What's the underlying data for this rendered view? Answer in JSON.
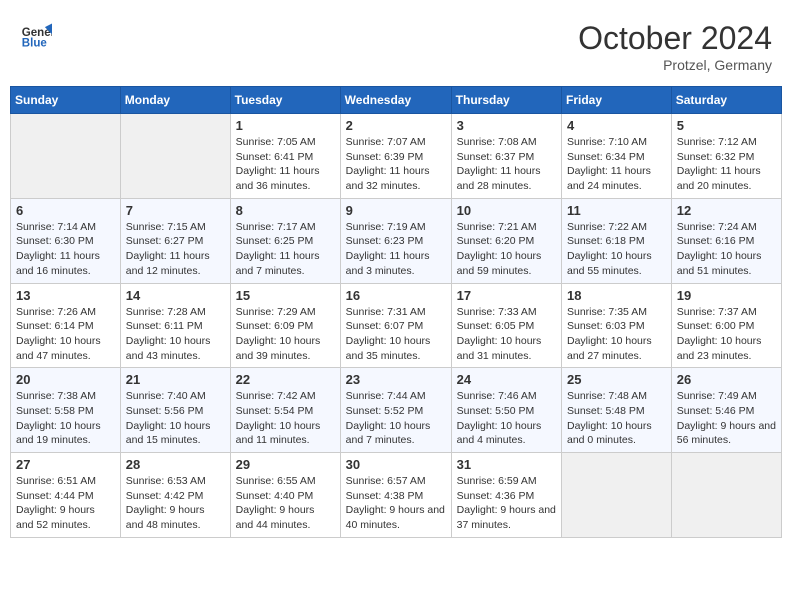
{
  "header": {
    "logo_line1": "General",
    "logo_line2": "Blue",
    "month": "October 2024",
    "location": "Protzel, Germany"
  },
  "weekdays": [
    "Sunday",
    "Monday",
    "Tuesday",
    "Wednesday",
    "Thursday",
    "Friday",
    "Saturday"
  ],
  "weeks": [
    [
      {
        "day": "",
        "sunrise": "",
        "sunset": "",
        "daylight": ""
      },
      {
        "day": "",
        "sunrise": "",
        "sunset": "",
        "daylight": ""
      },
      {
        "day": "1",
        "sunrise": "Sunrise: 7:05 AM",
        "sunset": "Sunset: 6:41 PM",
        "daylight": "Daylight: 11 hours and 36 minutes."
      },
      {
        "day": "2",
        "sunrise": "Sunrise: 7:07 AM",
        "sunset": "Sunset: 6:39 PM",
        "daylight": "Daylight: 11 hours and 32 minutes."
      },
      {
        "day": "3",
        "sunrise": "Sunrise: 7:08 AM",
        "sunset": "Sunset: 6:37 PM",
        "daylight": "Daylight: 11 hours and 28 minutes."
      },
      {
        "day": "4",
        "sunrise": "Sunrise: 7:10 AM",
        "sunset": "Sunset: 6:34 PM",
        "daylight": "Daylight: 11 hours and 24 minutes."
      },
      {
        "day": "5",
        "sunrise": "Sunrise: 7:12 AM",
        "sunset": "Sunset: 6:32 PM",
        "daylight": "Daylight: 11 hours and 20 minutes."
      }
    ],
    [
      {
        "day": "6",
        "sunrise": "Sunrise: 7:14 AM",
        "sunset": "Sunset: 6:30 PM",
        "daylight": "Daylight: 11 hours and 16 minutes."
      },
      {
        "day": "7",
        "sunrise": "Sunrise: 7:15 AM",
        "sunset": "Sunset: 6:27 PM",
        "daylight": "Daylight: 11 hours and 12 minutes."
      },
      {
        "day": "8",
        "sunrise": "Sunrise: 7:17 AM",
        "sunset": "Sunset: 6:25 PM",
        "daylight": "Daylight: 11 hours and 7 minutes."
      },
      {
        "day": "9",
        "sunrise": "Sunrise: 7:19 AM",
        "sunset": "Sunset: 6:23 PM",
        "daylight": "Daylight: 11 hours and 3 minutes."
      },
      {
        "day": "10",
        "sunrise": "Sunrise: 7:21 AM",
        "sunset": "Sunset: 6:20 PM",
        "daylight": "Daylight: 10 hours and 59 minutes."
      },
      {
        "day": "11",
        "sunrise": "Sunrise: 7:22 AM",
        "sunset": "Sunset: 6:18 PM",
        "daylight": "Daylight: 10 hours and 55 minutes."
      },
      {
        "day": "12",
        "sunrise": "Sunrise: 7:24 AM",
        "sunset": "Sunset: 6:16 PM",
        "daylight": "Daylight: 10 hours and 51 minutes."
      }
    ],
    [
      {
        "day": "13",
        "sunrise": "Sunrise: 7:26 AM",
        "sunset": "Sunset: 6:14 PM",
        "daylight": "Daylight: 10 hours and 47 minutes."
      },
      {
        "day": "14",
        "sunrise": "Sunrise: 7:28 AM",
        "sunset": "Sunset: 6:11 PM",
        "daylight": "Daylight: 10 hours and 43 minutes."
      },
      {
        "day": "15",
        "sunrise": "Sunrise: 7:29 AM",
        "sunset": "Sunset: 6:09 PM",
        "daylight": "Daylight: 10 hours and 39 minutes."
      },
      {
        "day": "16",
        "sunrise": "Sunrise: 7:31 AM",
        "sunset": "Sunset: 6:07 PM",
        "daylight": "Daylight: 10 hours and 35 minutes."
      },
      {
        "day": "17",
        "sunrise": "Sunrise: 7:33 AM",
        "sunset": "Sunset: 6:05 PM",
        "daylight": "Daylight: 10 hours and 31 minutes."
      },
      {
        "day": "18",
        "sunrise": "Sunrise: 7:35 AM",
        "sunset": "Sunset: 6:03 PM",
        "daylight": "Daylight: 10 hours and 27 minutes."
      },
      {
        "day": "19",
        "sunrise": "Sunrise: 7:37 AM",
        "sunset": "Sunset: 6:00 PM",
        "daylight": "Daylight: 10 hours and 23 minutes."
      }
    ],
    [
      {
        "day": "20",
        "sunrise": "Sunrise: 7:38 AM",
        "sunset": "Sunset: 5:58 PM",
        "daylight": "Daylight: 10 hours and 19 minutes."
      },
      {
        "day": "21",
        "sunrise": "Sunrise: 7:40 AM",
        "sunset": "Sunset: 5:56 PM",
        "daylight": "Daylight: 10 hours and 15 minutes."
      },
      {
        "day": "22",
        "sunrise": "Sunrise: 7:42 AM",
        "sunset": "Sunset: 5:54 PM",
        "daylight": "Daylight: 10 hours and 11 minutes."
      },
      {
        "day": "23",
        "sunrise": "Sunrise: 7:44 AM",
        "sunset": "Sunset: 5:52 PM",
        "daylight": "Daylight: 10 hours and 7 minutes."
      },
      {
        "day": "24",
        "sunrise": "Sunrise: 7:46 AM",
        "sunset": "Sunset: 5:50 PM",
        "daylight": "Daylight: 10 hours and 4 minutes."
      },
      {
        "day": "25",
        "sunrise": "Sunrise: 7:48 AM",
        "sunset": "Sunset: 5:48 PM",
        "daylight": "Daylight: 10 hours and 0 minutes."
      },
      {
        "day": "26",
        "sunrise": "Sunrise: 7:49 AM",
        "sunset": "Sunset: 5:46 PM",
        "daylight": "Daylight: 9 hours and 56 minutes."
      }
    ],
    [
      {
        "day": "27",
        "sunrise": "Sunrise: 6:51 AM",
        "sunset": "Sunset: 4:44 PM",
        "daylight": "Daylight: 9 hours and 52 minutes."
      },
      {
        "day": "28",
        "sunrise": "Sunrise: 6:53 AM",
        "sunset": "Sunset: 4:42 PM",
        "daylight": "Daylight: 9 hours and 48 minutes."
      },
      {
        "day": "29",
        "sunrise": "Sunrise: 6:55 AM",
        "sunset": "Sunset: 4:40 PM",
        "daylight": "Daylight: 9 hours and 44 minutes."
      },
      {
        "day": "30",
        "sunrise": "Sunrise: 6:57 AM",
        "sunset": "Sunset: 4:38 PM",
        "daylight": "Daylight: 9 hours and 40 minutes."
      },
      {
        "day": "31",
        "sunrise": "Sunrise: 6:59 AM",
        "sunset": "Sunset: 4:36 PM",
        "daylight": "Daylight: 9 hours and 37 minutes."
      },
      {
        "day": "",
        "sunrise": "",
        "sunset": "",
        "daylight": ""
      },
      {
        "day": "",
        "sunrise": "",
        "sunset": "",
        "daylight": ""
      }
    ]
  ]
}
